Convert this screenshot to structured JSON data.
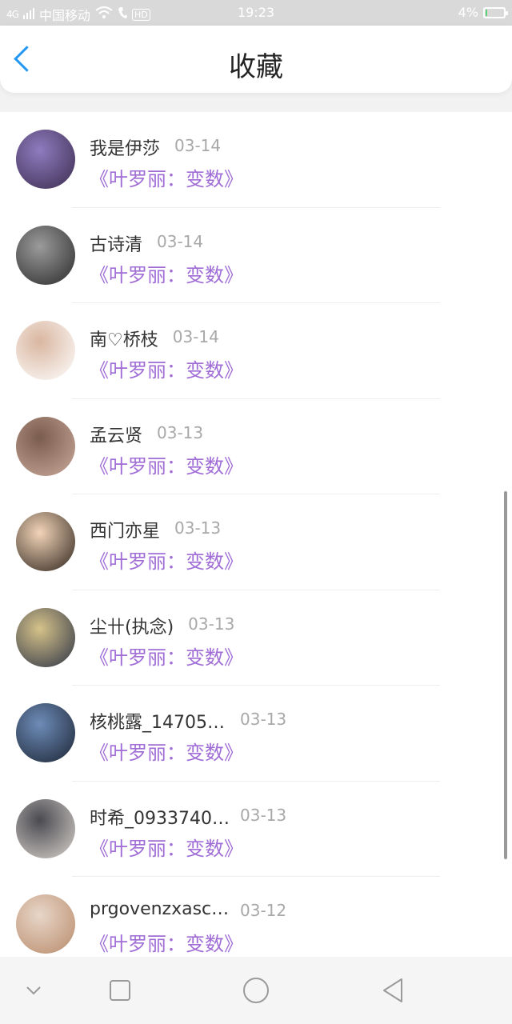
{
  "status_bar": {
    "carrier": "中国移动",
    "signal_label": "4G",
    "hd_label": "HD",
    "time": "19:23",
    "battery_text": "4%",
    "battery_level": 0.04
  },
  "header": {
    "title": "收藏"
  },
  "items": [
    {
      "name": "我是伊莎",
      "date": "03-14",
      "book": "《叶罗丽：变数》",
      "avatar_colors": [
        "#3b2c4e",
        "#8f7bbf"
      ]
    },
    {
      "name": "古诗清",
      "date": "03-14",
      "book": "《叶罗丽：变数》",
      "avatar_colors": [
        "#2a2a2a",
        "#9b9b9b"
      ]
    },
    {
      "name": "南♡桥枝",
      "date": "03-14",
      "book": "《叶罗丽：变数》",
      "avatar_colors": [
        "#ffffff",
        "#d9b6a0"
      ]
    },
    {
      "name": "孟云贤",
      "date": "03-13",
      "book": "《叶罗丽：变数》",
      "avatar_colors": [
        "#c9a99a",
        "#7a5c4e"
      ]
    },
    {
      "name": "西门亦星",
      "date": "03-13",
      "book": "《叶罗丽：变数》",
      "avatar_colors": [
        "#2e241c",
        "#f2d4b8"
      ]
    },
    {
      "name": "尘卄(执念)",
      "date": "03-13",
      "book": "《叶罗丽：变数》",
      "avatar_colors": [
        "#2c3245",
        "#d6c38a"
      ]
    },
    {
      "name": "核桃露_14705…",
      "date": "03-13",
      "book": "《叶罗丽：变数》",
      "avatar_colors": [
        "#1b2433",
        "#6e8cb8"
      ]
    },
    {
      "name": "时希_0933740…",
      "date": "03-13",
      "book": "《叶罗丽：变数》",
      "avatar_colors": [
        "#d8d2cc",
        "#4a4a50"
      ]
    },
    {
      "name": "prgovenzxascho…",
      "date": "03-12",
      "book": "《叶罗丽：变数》",
      "avatar_colors": [
        "#b88b6b",
        "#e8d6c8"
      ]
    }
  ],
  "nav": [
    "chevron-down-icon",
    "square-icon",
    "circle-icon",
    "triangle-back-icon"
  ]
}
